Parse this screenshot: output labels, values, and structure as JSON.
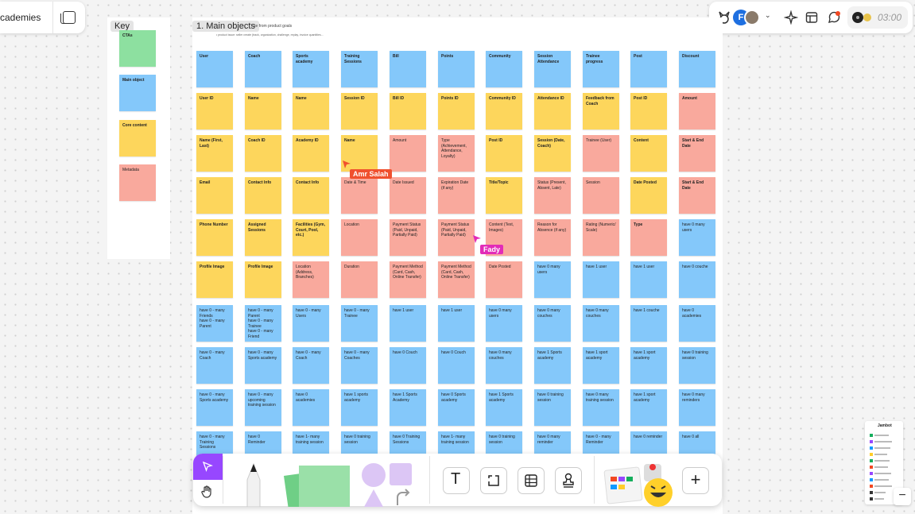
{
  "header": {
    "file_title": "cademies",
    "timer": "03:00",
    "avatar_initial": "F"
  },
  "key": {
    "title": "Key",
    "items": [
      {
        "label": "CTAs",
        "color": "#8de0a0"
      },
      {
        "label": "Main object",
        "color": "#84c8fa"
      },
      {
        "label": "Core content",
        "color": "#fdd65c"
      },
      {
        "label": "Metadata",
        "color": "#f9a99d"
      }
    ]
  },
  "board": {
    "title": "1. Main objects",
    "subtitle": "...te from product goals",
    "note": "• product issue: seller create (track, organization, challenge, replay, invoice quantities..."
  },
  "columns": [
    {
      "notes": [
        {
          "t": "User",
          "c": "b",
          "w": 1
        },
        {
          "t": "User ID",
          "c": "y",
          "w": 1
        },
        {
          "t": "Name (First, Last)",
          "c": "y",
          "w": 1
        },
        {
          "t": "Email",
          "c": "y",
          "w": 1
        },
        {
          "t": "Phone Number",
          "c": "y",
          "w": 1
        },
        {
          "t": "Profile Image",
          "c": "y",
          "w": 1
        },
        {
          "t": "have 0 - many Friends\nhave 0 - many Parent",
          "c": "b"
        },
        {
          "t": "have 0 - many Coach",
          "c": "b"
        },
        {
          "t": "have 0 - many Sports academy",
          "c": "b"
        },
        {
          "t": "have 0 - many Training Sessions",
          "c": "b"
        }
      ]
    },
    {
      "notes": [
        {
          "t": "Coach",
          "c": "b",
          "w": 1
        },
        {
          "t": "Name",
          "c": "y",
          "w": 1
        },
        {
          "t": "Coach ID",
          "c": "y",
          "w": 1
        },
        {
          "t": "Contact Info",
          "c": "y",
          "w": 1
        },
        {
          "t": "Assigned Sessions",
          "c": "y",
          "w": 1
        },
        {
          "t": "Profile Image",
          "c": "y",
          "w": 1
        },
        {
          "t": "have 0 - many Parent\nhave 0 - many Trainee\nhave 0 - many Friend",
          "c": "b"
        },
        {
          "t": "have 0 - many Sports academy",
          "c": "b"
        },
        {
          "t": "have 0 - many upcoming training session",
          "c": "b"
        },
        {
          "t": "have 0 Reminder",
          "c": "b"
        }
      ]
    },
    {
      "notes": [
        {
          "t": "Sports academy",
          "c": "b",
          "w": 1
        },
        {
          "t": "Name",
          "c": "y",
          "w": 1
        },
        {
          "t": "Academy ID",
          "c": "y",
          "w": 1
        },
        {
          "t": "Contact Info",
          "c": "y",
          "w": 1
        },
        {
          "t": "Facilities (Gym, Court, Pool, etc.)",
          "c": "y",
          "w": 1
        },
        {
          "t": "Location (Address, Branches)",
          "c": "p"
        },
        {
          "t": "have 0 - many Users",
          "c": "b"
        },
        {
          "t": "have 0 - many Coach",
          "c": "b"
        },
        {
          "t": "have 0 academies",
          "c": "b"
        },
        {
          "t": "have 1- many training session",
          "c": "b"
        }
      ]
    },
    {
      "notes": [
        {
          "t": "Training Sessions",
          "c": "b",
          "w": 1
        },
        {
          "t": "Session ID",
          "c": "y",
          "w": 1
        },
        {
          "t": "Name",
          "c": "y",
          "w": 1
        },
        {
          "t": "Date & Time",
          "c": "p"
        },
        {
          "t": "Location",
          "c": "p"
        },
        {
          "t": "Duration",
          "c": "p"
        },
        {
          "t": "have 0 - many Trainee",
          "c": "b"
        },
        {
          "t": "have 0 - many Coaches",
          "c": "b"
        },
        {
          "t": "have 1 sports academy",
          "c": "b"
        },
        {
          "t": "have 0 training session",
          "c": "b"
        }
      ]
    },
    {
      "notes": [
        {
          "t": "Bill",
          "c": "b",
          "w": 1
        },
        {
          "t": "Bill ID",
          "c": "y",
          "w": 1
        },
        {
          "t": "Amount",
          "c": "p"
        },
        {
          "t": "Date Issued",
          "c": "p"
        },
        {
          "t": "Payment Status (Paid, Unpaid, Partially Paid)",
          "c": "p"
        },
        {
          "t": "Payment Method (Card, Cash, Online Transfer)",
          "c": "p"
        },
        {
          "t": "have 1 user",
          "c": "b"
        },
        {
          "t": "have 0 Couch",
          "c": "b"
        },
        {
          "t": "have 1 Sports Academy",
          "c": "b"
        },
        {
          "t": "have 0 Training Sessions",
          "c": "b"
        }
      ]
    },
    {
      "notes": [
        {
          "t": "Points",
          "c": "b",
          "w": 1
        },
        {
          "t": "Points ID",
          "c": "y",
          "w": 1
        },
        {
          "t": "Type (Achievement, Attendance, Loyalty)",
          "c": "p"
        },
        {
          "t": "Expiration Date (if any)",
          "c": "p"
        },
        {
          "t": "Payment Status (Paid, Unpaid, Partially Paid)",
          "c": "p"
        },
        {
          "t": "Payment Method (Card, Cash, Online Transfer)",
          "c": "p"
        },
        {
          "t": "have 1 user",
          "c": "b"
        },
        {
          "t": "have 0 Couch",
          "c": "b"
        },
        {
          "t": "have 0 Sports academy",
          "c": "b"
        },
        {
          "t": "have 1- many training session",
          "c": "b"
        }
      ]
    },
    {
      "notes": [
        {
          "t": "Community",
          "c": "b",
          "w": 1
        },
        {
          "t": "Community ID",
          "c": "y",
          "w": 1
        },
        {
          "t": "Post ID",
          "c": "y",
          "w": 1
        },
        {
          "t": "Title/Topic",
          "c": "y",
          "w": 1
        },
        {
          "t": "Content (Text, Images)",
          "c": "p"
        },
        {
          "t": "Date Posted",
          "c": "p"
        },
        {
          "t": "have 0 many users",
          "c": "b"
        },
        {
          "t": "have 0 many couches",
          "c": "b"
        },
        {
          "t": "have 1 Sports academy",
          "c": "b"
        },
        {
          "t": "have 0 training session",
          "c": "b"
        }
      ]
    },
    {
      "notes": [
        {
          "t": "Session Attendance",
          "c": "b",
          "w": 1
        },
        {
          "t": "Attendance ID",
          "c": "y",
          "w": 1
        },
        {
          "t": "Session (Date, Coach)",
          "c": "y",
          "w": 1
        },
        {
          "t": "Status (Present, Absent, Late)",
          "c": "p"
        },
        {
          "t": "Reason for Absence (if any)",
          "c": "p"
        },
        {
          "t": "have 0 many users",
          "c": "b"
        },
        {
          "t": "have 0 many couches",
          "c": "b"
        },
        {
          "t": "have 1 Sports academy",
          "c": "b"
        },
        {
          "t": "have 0 training session",
          "c": "b"
        },
        {
          "t": "have 0 many reminder",
          "c": "b"
        }
      ]
    },
    {
      "notes": [
        {
          "t": "Trainee progress",
          "c": "b",
          "w": 1
        },
        {
          "t": "Feedback from Coach",
          "c": "y",
          "w": 1
        },
        {
          "t": "Trainee (User)",
          "c": "p"
        },
        {
          "t": "Session",
          "c": "p"
        },
        {
          "t": "Rating (Numeric/ Scale)",
          "c": "p"
        },
        {
          "t": "have 1 user",
          "c": "b"
        },
        {
          "t": "have 0 many couches",
          "c": "b"
        },
        {
          "t": "have 1 sport academy",
          "c": "b"
        },
        {
          "t": "have 0 many training session",
          "c": "b"
        },
        {
          "t": "have 0 - many Reminder",
          "c": "b"
        }
      ]
    },
    {
      "notes": [
        {
          "t": "Post",
          "c": "b",
          "w": 1
        },
        {
          "t": "Post ID",
          "c": "y",
          "w": 1
        },
        {
          "t": "Content",
          "c": "y",
          "w": 1
        },
        {
          "t": "Date Posted",
          "c": "y",
          "w": 1
        },
        {
          "t": "Type",
          "c": "p",
          "w": 1
        },
        {
          "t": "have 1 user",
          "c": "b"
        },
        {
          "t": "have 1 couche",
          "c": "b"
        },
        {
          "t": "have 1 sport academy",
          "c": "b"
        },
        {
          "t": "have 1 sport academy",
          "c": "b"
        },
        {
          "t": "have 0 reminder",
          "c": "b"
        }
      ]
    },
    {
      "notes": [
        {
          "t": "Discount",
          "c": "b",
          "w": 1
        },
        {
          "t": "Amount",
          "c": "p",
          "w": 1
        },
        {
          "t": "Start & End Date",
          "c": "p",
          "w": 1
        },
        {
          "t": "Start & End Date",
          "c": "p",
          "w": 1
        },
        {
          "t": "have 0 many users",
          "c": "b"
        },
        {
          "t": "have 0 couche",
          "c": "b"
        },
        {
          "t": "have 0 academies",
          "c": "b"
        },
        {
          "t": "have 0 training session",
          "c": "b"
        },
        {
          "t": "have 0 many reminders",
          "c": "b"
        },
        {
          "t": "have 0 all",
          "c": "b"
        }
      ]
    }
  ],
  "cursors": [
    {
      "name": "Amr Salah",
      "color": "#f0502e"
    },
    {
      "name": "Fady",
      "color": "#e22bb8"
    }
  ],
  "toolbar": {
    "text_tool": "T",
    "add_label": "+",
    "zoom_out": "−"
  },
  "mini_panel": {
    "title": "Jambot"
  }
}
